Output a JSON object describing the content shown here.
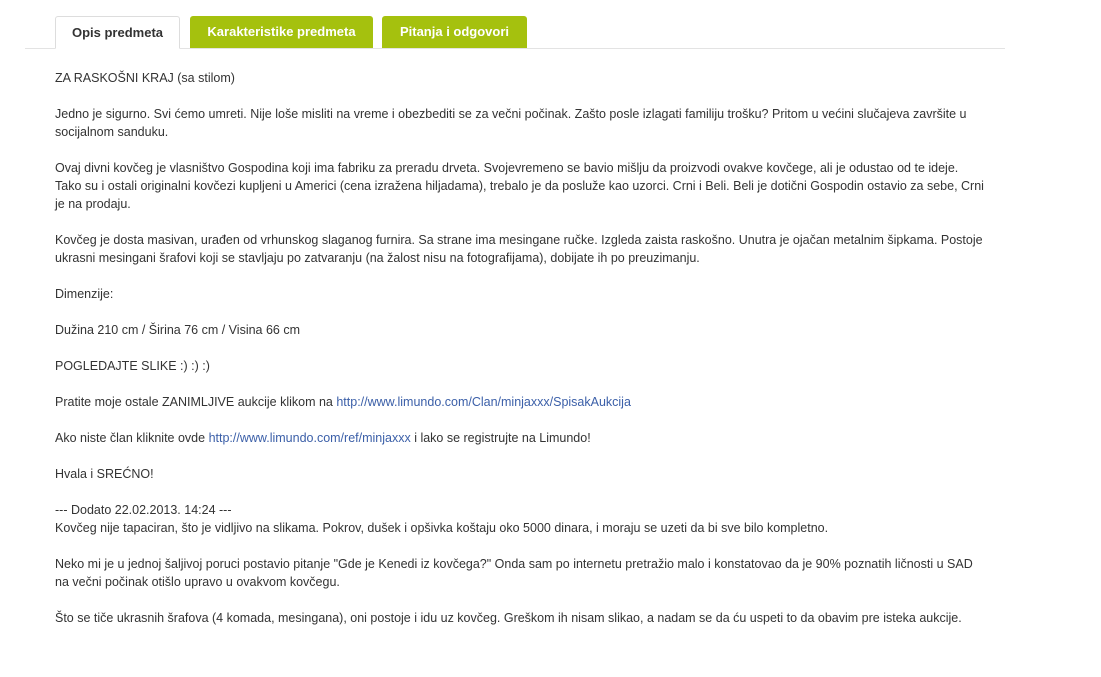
{
  "tabs": {
    "description": "Opis predmeta",
    "characteristics": "Karakteristike predmeta",
    "qa": "Pitanja i odgovori"
  },
  "colors": {
    "tab_green": "#a5c10e",
    "link": "#3b5fa8",
    "text": "#333333"
  },
  "content": {
    "p1": "ZA RASKOŠNI KRAJ (sa stilom)",
    "p2": "Jedno je sigurno. Svi ćemo umreti. Nije loše misliti na vreme i obezbediti se za večni počinak. Zašto posle izlagati familiju trošku? Pritom u većini slučajeva završite u socijalnom sanduku.",
    "p3": "Ovaj divni kovčeg je vlasništvo Gospodina koji ima fabriku za preradu drveta. Svojevremeno se bavio mišlju da proizvodi ovakve kovčege, ali je odustao od te ideje. Tako su i ostali originalni kovčezi kupljeni u Americi (cena izražena hiljadama), trebalo je da posluže kao uzorci. Crni i Beli. Beli je dotični Gospodin ostavio za sebe, Crni je na prodaju.",
    "p4": "Kovčeg je dosta masivan, urađen od vrhunskog slaganog furnira. Sa strane ima mesingane ručke. Izgleda zaista raskošno. Unutra je ojačan metalnim šipkama. Postoje ukrasni mesingani šrafovi koji se stavljaju po zatvaranju (na žalost nisu na fotografijama), dobijate ih po preuzimanju.",
    "p5": "Dimenzije:",
    "p6": "Dužina 210 cm / Širina 76 cm / Visina 66 cm",
    "p7": "POGLEDAJTE SLIKE :) :) :)",
    "p8_prefix": "Pratite moje ostale ZANIMLJIVE aukcije klikom na ",
    "p8_link": "http://www.limundo.com/Clan/minjaxxx/SpisakAukcija",
    "p9_prefix": "Ako niste član kliknite ovde ",
    "p9_link": "http://www.limundo.com/ref/minjaxxx",
    "p9_suffix": " i lako se registrujte na Limundo!",
    "p10": "Hvala i SREĆNO!",
    "p11_header": "--- Dodato 22.02.2013. 14:24 ---",
    "p11": "Kovčeg nije tapaciran, što je vidljivo na slikama. Pokrov, dušek i opšivka koštaju oko 5000 dinara, i moraju se uzeti da bi sve bilo kompletno.",
    "p12": "Neko mi je u jednoj šaljivoj poruci postavio pitanje \"Gde je Kenedi iz kovčega?\" Onda sam po internetu pretražio malo i konstatovao da je 90% poznatih ličnosti u SAD na večni počinak otišlo upravo u ovakvom kovčegu.",
    "p13": "Što se tiče ukrasnih šrafova (4 komada, mesingana), oni postoje i idu uz kovčeg. Greškom ih nisam slikao, a nadam se da ću uspeti to da obavim pre isteka aukcije."
  }
}
